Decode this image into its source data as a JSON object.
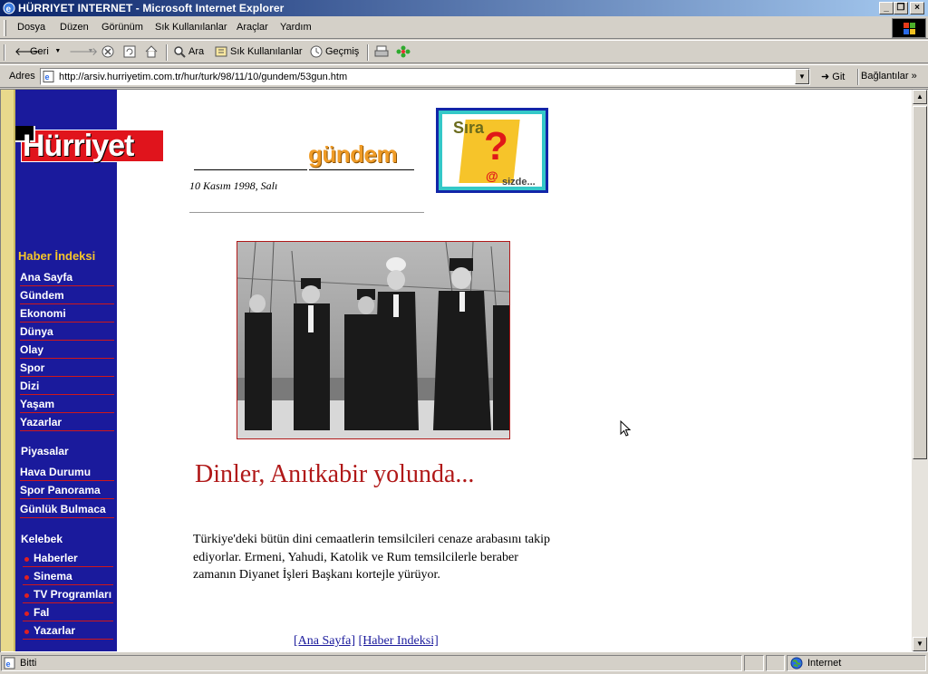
{
  "window": {
    "title": "HÜRRIYET INTERNET - Microsoft Internet Explorer"
  },
  "menu": {
    "items": [
      "Dosya",
      "Düzen",
      "Görünüm",
      "Sık Kullanılanlar",
      "Araçlar",
      "Yardım"
    ]
  },
  "toolbar": {
    "back": "Geri",
    "search": "Ara",
    "favorites": "Sık Kullanılanlar",
    "history": "Geçmiş"
  },
  "address": {
    "label": "Adres",
    "url": "http://arsiv.hurriyetim.com.tr/hur/turk/98/11/10/gundem/53gun.htm",
    "go": "Git",
    "links": "Bağlantılar"
  },
  "sidebar": {
    "logo": "Hürriyet",
    "index_title": "Haber İndeksi",
    "items": [
      "Ana Sayfa",
      "Gündem",
      "Ekonomi",
      "Dünya",
      "Olay",
      "Spor",
      "Dizi",
      "Yaşam",
      "Yazarlar"
    ],
    "markets_title": "Piyasalar",
    "extras": [
      "Hava Durumu",
      "Spor Panorama",
      "Günlük Bulmaca"
    ],
    "kelebek_title": "Kelebek",
    "kelebek_items": [
      "Haberler",
      "Sinema",
      "TV Programları",
      "Fal",
      "Yazarlar"
    ]
  },
  "article": {
    "section": "gündem",
    "date": "10 Kasım 1998, Salı",
    "headline": "Dinler, Anıtkabir yolunda...",
    "body": "Türkiye'deki bütün dini cemaatlerin temsilcileri cenaze arabasını takip ediyorlar. Ermeni, Yahudi, Katolik ve Rum temsilcilerle beraber zamanın Diyanet İşleri Başkanı kortejle yürüyor.",
    "footer_home": "[Ana Sayfa]",
    "footer_index": "[Haber Indeksi]"
  },
  "banner": {
    "title": "Sıra",
    "symbol": "?",
    "at": "@",
    "subtitle": "sizde..."
  },
  "status": {
    "text": "Bitti",
    "zone": "Internet"
  }
}
